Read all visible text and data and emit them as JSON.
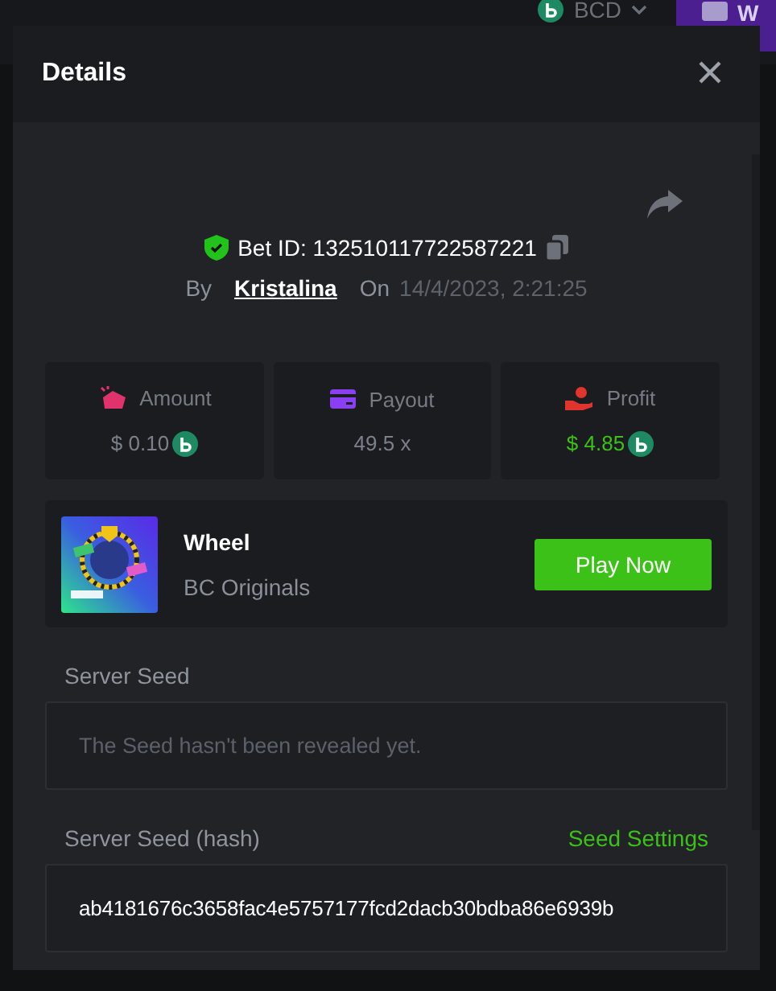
{
  "background": {
    "currency": "BCD",
    "action_button": "W"
  },
  "dialog": {
    "title": "Details",
    "bet_id_label": "Bet ID:",
    "bet_id": "132510117722587221",
    "by_label": "By",
    "player": "Kristalina",
    "on_label": "On",
    "date": "14/4/2023, 2:21:25",
    "stats": [
      {
        "kind": "amount",
        "label": "Amount",
        "value": "$ 0.10",
        "coin": true
      },
      {
        "kind": "payout",
        "label": "Payout",
        "value": "49.5 x",
        "coin": false
      },
      {
        "kind": "profit",
        "label": "Profit",
        "value": "$ 4.85",
        "coin": true
      }
    ],
    "game": {
      "name": "Wheel",
      "provider": "BC Originals",
      "button": "Play Now"
    },
    "server_seed": {
      "label": "Server Seed",
      "text": "The Seed hasn't been revealed yet."
    },
    "hash": {
      "label": "Server Seed (hash)",
      "link": "Seed Settings",
      "value": "ab4181676c3658fac4e5757177fcd2dacb30bdba86e6939b"
    }
  }
}
